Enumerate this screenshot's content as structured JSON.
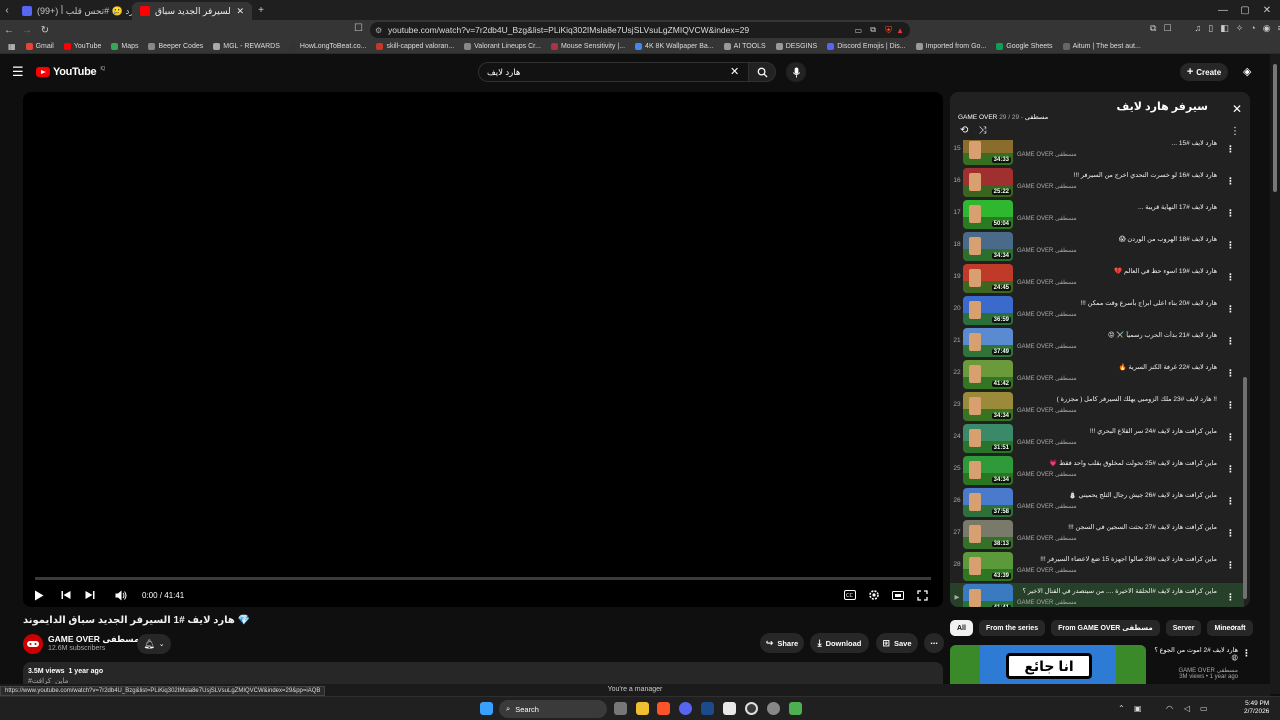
{
  "browser": {
    "tabs": [
      {
        "label": "(99+) إراج نشتاق لتكارد 🥲 #تحس قلب أ...",
        "active": false,
        "fav_color": "#5865f2"
      },
      {
        "label": "هارد لايف #1 السيرفر الجديد سباق",
        "active": true,
        "fav_color": "#ff0000"
      }
    ],
    "url": "youtube.com/watch?v=7r2db4U_Bzg&list=PLiKiq302IMsla8e7UsjSLVsuLgZMIQVCW&index=29",
    "bookmarks": [
      "Gmail",
      "YouTube",
      "Maps",
      "Beeper Codes",
      "MGL - REWARDS",
      "HowLongToBeat.co...",
      "skill-capped valoran...",
      "Valorant Lineups Cr...",
      "Mouse Sensitivity |...",
      "4K 8K Wallpaper Ba...",
      "AI TOOLS",
      "DESGINS",
      "Discord Emojis | Dis...",
      "Imported from Go...",
      "Google Sheets",
      "Aitum | The best aut..."
    ],
    "bookmark_colors": [
      "#ea4335",
      "#ff0000",
      "#34a853",
      "#888888",
      "#aaaaaa",
      "#333333",
      "#c0392b",
      "#888888",
      "#aa3344",
      "#4285f4",
      "#999999",
      "#999999",
      "#5865f2",
      "#999999",
      "#0f9d58",
      "#666666"
    ]
  },
  "youtube": {
    "logo": "YouTube",
    "logo_region": "IQ",
    "search_query": "هارد لايف",
    "create_label": "Create"
  },
  "player": {
    "time": "0:00 / 41:41",
    "progress": 0
  },
  "video": {
    "title": "هارد لايف #1 السيرفر الجديد سباق الدايموند 💎",
    "channel": "GAME OVER مسطفى",
    "subscribers": "12.6M subscribers",
    "share_label": "Share",
    "download_label": "Download",
    "save_label": "Save",
    "views": "3.5M views",
    "age": "1 year ago",
    "desc_more": "#ماين_كرافت"
  },
  "playlist": {
    "title": "سيرفر هارد لايف",
    "channel": "GAME OVER مسطفى",
    "position": "29 / 29",
    "channel_line": "GAME OVER مسطفى - 29 / 29",
    "items": [
      {
        "idx": "15",
        "title": "هارد لايف #15 ...",
        "channel": "GAME OVER مسطفى",
        "duration": "34:33",
        "thumb": "#8a6d2c"
      },
      {
        "idx": "16",
        "title": "هارد لايف #16 لو خسرت التحدي اخرج من السيرفر !!!",
        "channel": "GAME OVER مسطفى",
        "duration": "25:22",
        "thumb": "#a03030"
      },
      {
        "idx": "17",
        "title": "هارد لايف #17 النهاية قريبة ...",
        "channel": "GAME OVER مسطفى",
        "duration": "50:04",
        "thumb": "#2fb82f"
      },
      {
        "idx": "18",
        "title": "هارد لايف #18 الهروب من الوردن 😱",
        "channel": "GAME OVER مسطفى",
        "duration": "34:34",
        "thumb": "#4a6a8a"
      },
      {
        "idx": "19",
        "title": "هارد لايف #19 اسوء حظ في العالم 💔",
        "channel": "GAME OVER مسطفى",
        "duration": "24:45",
        "thumb": "#c03a2a"
      },
      {
        "idx": "20",
        "title": "هارد لايف #20 بناء اعلى ابراج بأسرع وقت ممكن !!!",
        "channel": "GAME OVER مسطفى",
        "duration": "36:59",
        "thumb": "#3a6acc"
      },
      {
        "idx": "21",
        "title": "هارد لايف #21 بدأت الحرب رسمياً ⚔️ 😡",
        "channel": "GAME OVER مسطفى",
        "duration": "37:49",
        "thumb": "#5a8ad0"
      },
      {
        "idx": "22",
        "title": "هارد لايف #22 غرفة الكنز السرية 🔥",
        "channel": "GAME OVER مسطفى",
        "duration": "41:42",
        "thumb": "#6a9a3a"
      },
      {
        "idx": "23",
        "title": "!! هارد لايف #23 ملك الزومبي يهلك السيرفر كامل ( مجزرة )",
        "channel": "GAME OVER مسطفى",
        "duration": "34:34",
        "thumb": "#9a8a3a"
      },
      {
        "idx": "24",
        "title": "ماين كرافت هارد لايف #24 سر القلاع البحري !!!",
        "channel": "GAME OVER مسطفى",
        "duration": "31:51",
        "thumb": "#3a8a6a"
      },
      {
        "idx": "25",
        "title": "ماين كرافت هارد لايف #25 تحولت لمخلوق بقلب واحد فقط 💗",
        "channel": "GAME OVER مسطفى",
        "duration": "34:34",
        "thumb": "#2e9a3a"
      },
      {
        "idx": "26",
        "title": "ماين كرافت هارد لايف #26 جيش رجال الثلج يحميني ⛄",
        "channel": "GAME OVER مسطفى",
        "duration": "37:58",
        "thumb": "#4a7acc"
      },
      {
        "idx": "27",
        "title": "ماين كرافت هارد لايف #27 بحثت السجين في السجن !!!",
        "channel": "GAME OVER مسطفى",
        "duration": "38:13",
        "thumb": "#7a7a6a"
      },
      {
        "idx": "28",
        "title": "ماين كرافت هارد لايف #28 صالوا اجهزة 15 ضع لاعضاء السيرفر !!!",
        "channel": "GAME OVER مسطفى",
        "duration": "43:39",
        "thumb": "#5a9a3a"
      },
      {
        "idx": "▶",
        "title": "ماين كرافت هارد لايف #الحلقة الاخيرة .... من سيتصدر في القتال الاخير ؟",
        "channel": "GAME OVER مسطفى",
        "duration": "41:41",
        "thumb": "#3a7ac0",
        "current": true
      }
    ]
  },
  "chips": [
    "All",
    "From the series",
    "From GAME OVER مسطفى",
    "Server",
    "Minecraft"
  ],
  "recommendation": {
    "title": "هارد لايف #2 اموت من الجوع ؟ 😩",
    "channel": "GAME OVER مسطفى",
    "meta": "3M views • 1 year ago",
    "thumb_text": "انا جائع"
  },
  "status": {
    "url": "https://www.youtube.com/watch?v=7r2db4U_Bzg&list=PLiKiq302IMsla8e7UsjSLVsuLgZMIQVCW&index=29&pp=iAQB",
    "manager": "You're a manager"
  },
  "taskbar": {
    "search": "Search",
    "time": "5:49 PM",
    "date": "2/7/2026"
  }
}
